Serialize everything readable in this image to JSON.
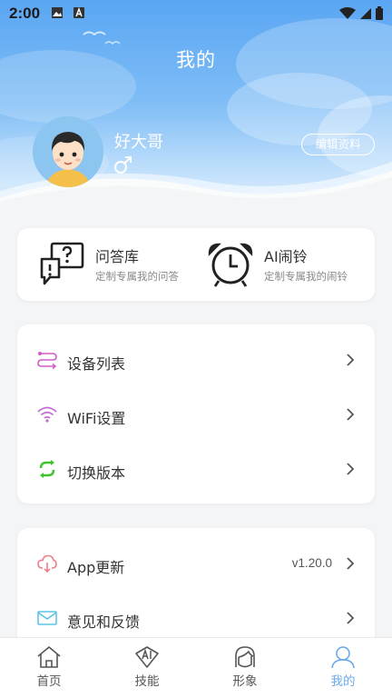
{
  "status_bar": {
    "time": "2:00"
  },
  "header": {
    "title": "我的"
  },
  "profile": {
    "name": "好大哥",
    "gender_symbol": "♂",
    "edit_label": "编辑资料"
  },
  "features": [
    {
      "title": "问答库",
      "subtitle": "定制专属我的问答",
      "icon": "qa-icon"
    },
    {
      "title": "AI闹铃",
      "subtitle": "定制专属我的闹铃",
      "icon": "alarm-clock-icon"
    }
  ],
  "menu_group1": [
    {
      "label": "设备列表",
      "icon": "device-list-icon"
    },
    {
      "label": "WiFi设置",
      "icon": "wifi-icon"
    },
    {
      "label": "切换版本",
      "icon": "switch-version-icon"
    }
  ],
  "menu_group2": [
    {
      "label": "App更新",
      "value": "v1.20.0",
      "icon": "cloud-update-icon"
    },
    {
      "label": "意见和反馈",
      "icon": "mail-icon"
    }
  ],
  "tabs": [
    {
      "label": "首页",
      "icon": "home-icon"
    },
    {
      "label": "技能",
      "icon": "ai-skill-icon"
    },
    {
      "label": "形象",
      "icon": "avatar-face-icon"
    },
    {
      "label": "我的",
      "icon": "profile-icon",
      "active": true
    }
  ],
  "colors": {
    "accent": "#6aa8ea",
    "header_top": "#5aa6f3",
    "device_icon": "#d35cc8",
    "wifi_icon": "#c36ad6",
    "switch_icon": "#3bc42c",
    "cloud_icon": "#f07e8c",
    "mail_icon": "#5cc6e8"
  }
}
